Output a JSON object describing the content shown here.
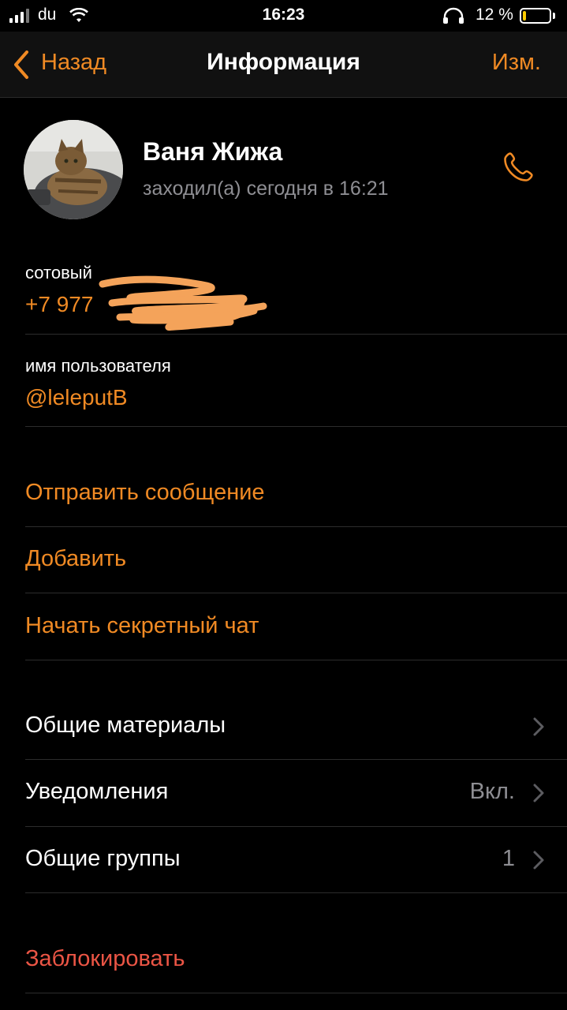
{
  "status_bar": {
    "carrier": "du",
    "time": "16:23",
    "battery_percent": "12 %",
    "battery_level": 0.12
  },
  "nav": {
    "back_label": "Назад",
    "title": "Информация",
    "edit_label": "Изм."
  },
  "profile": {
    "name": "Ваня Жижа",
    "last_seen": "заходил(а) сегодня в 16:21"
  },
  "phone": {
    "label": "сотовый",
    "value": "+7 977"
  },
  "username": {
    "label": "имя пользователя",
    "value": "@leleputB"
  },
  "actions": {
    "send_message": "Отправить сообщение",
    "add": "Добавить",
    "secret_chat": "Начать секретный чат"
  },
  "settings": {
    "shared_media": "Общие материалы",
    "notifications": "Уведомления",
    "notifications_value": "Вкл.",
    "groups": "Общие группы",
    "groups_value": "1"
  },
  "block": {
    "label": "Заблокировать"
  },
  "colors": {
    "accent": "#f08a24",
    "destructive": "#eb5545",
    "background": "#000000"
  }
}
